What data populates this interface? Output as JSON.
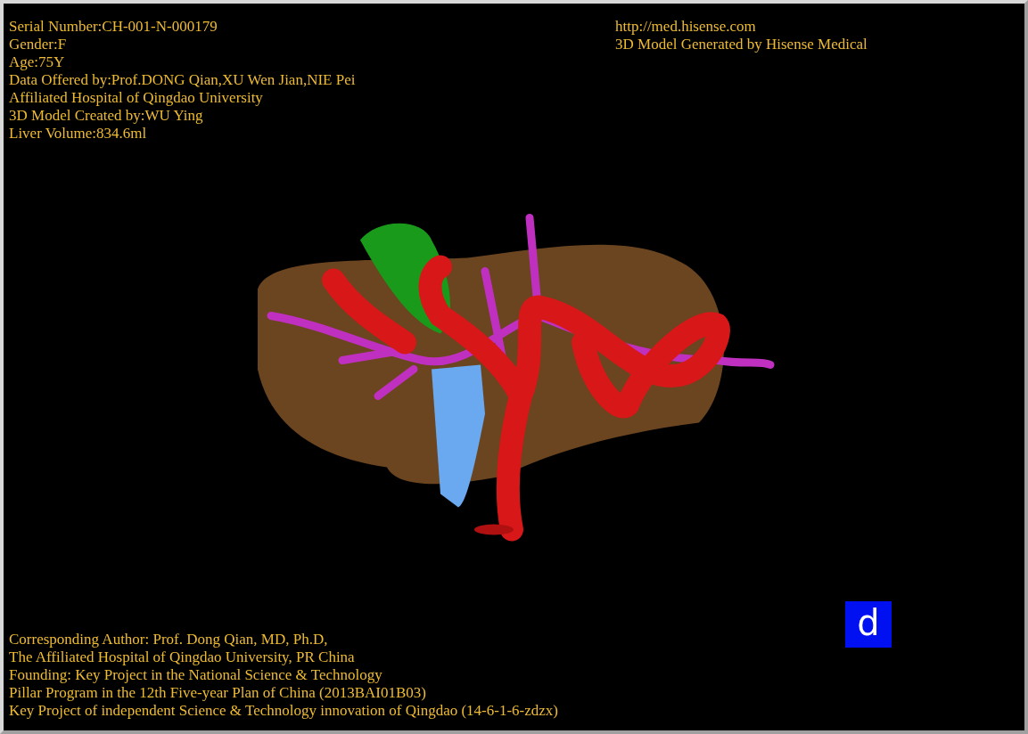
{
  "info_top_left": [
    "Serial Number:CH-001-N-000179",
    "Gender:F",
    "Age:75Y",
    "Data Offered by:Prof.DONG Qian,XU Wen Jian,NIE Pei",
    "Affiliated Hospital of Qingdao University",
    "3D Model Created by:WU Ying",
    "Liver Volume:834.6ml"
  ],
  "info_top_right": [
    "http://med.hisense.com",
    "3D Model Generated by Hisense Medical"
  ],
  "info_bottom_left": [
    "Corresponding Author: Prof. Dong Qian, MD, Ph.D,",
    "The Affiliated Hospital of Qingdao University, PR China",
    "Founding: Key Project in the National Science & Technology",
    "Pillar Program in the 12th Five-year Plan of China (2013BAI01B03)",
    "Key Project of independent Science & Technology innovation of Qingdao (14-6-1-6-zdzx)"
  ],
  "orientation_label": "d"
}
